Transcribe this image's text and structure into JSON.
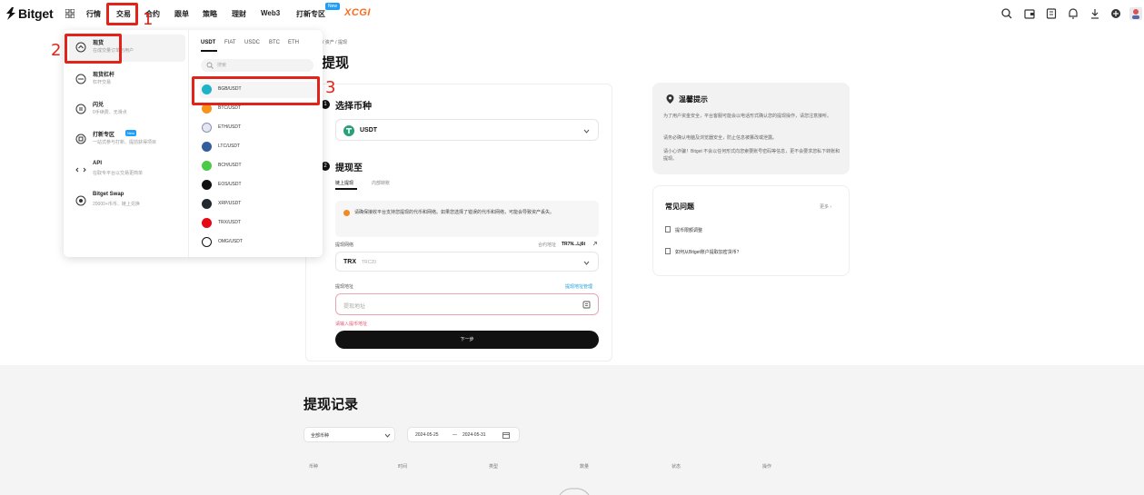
{
  "header": {
    "logo": "Bitget",
    "nav": [
      "行情",
      "交易",
      "合约",
      "跟单",
      "策略",
      "理财",
      "Web3",
      "打新专区"
    ],
    "nav_badge": "New",
    "promo": "XCGI"
  },
  "annotations": {
    "n1": "1",
    "n2": "2",
    "n3": "3"
  },
  "trade_menu": {
    "items": [
      {
        "title": "现货",
        "sub": "在成交量订单与用户"
      },
      {
        "title": "现货杠杆",
        "sub": "杠杆交易"
      },
      {
        "title": "闪兑",
        "sub": "0手续费、无滑点"
      },
      {
        "title": "打新专区",
        "sub": "一站式参与打新、提前获得项目",
        "badge": "New"
      },
      {
        "title": "API",
        "sub": "在取专平台以交易更简单"
      },
      {
        "title": "Bitget Swap",
        "sub": "20000+币币、链上兑换"
      }
    ],
    "currency_tabs": [
      "USDT",
      "FIAT",
      "USDC",
      "BTC",
      "ETH"
    ],
    "search_placeholder": "搜索",
    "pairs": [
      "BGB/USDT",
      "BTC/USDT",
      "ETH/USDT",
      "LTC/USDT",
      "BCH/USDT",
      "EOS/USDT",
      "XRP/USDT",
      "TRX/USDT",
      "OMG/USDT"
    ]
  },
  "page": {
    "breadcrumb": "/ 资产 / 提现",
    "title": "提现",
    "step1": {
      "num": "1",
      "title": "选择币种",
      "coin": "USDT"
    },
    "step2": {
      "num": "2",
      "title": "提现至",
      "tabs": [
        "链上提现",
        "内部转账"
      ],
      "notice": "请确保接收平台支持您提现的代币和网络。如果您选择了错误的代币和网络，可能会导致资产丢失。",
      "network_label": "提现网络",
      "contract_label": "合约地址",
      "contract_value": "TR7N...Lj6t",
      "network_value": "TRX",
      "network_sub": "TRC20",
      "address_label": "提现地址",
      "address_manage": "提现地址管理",
      "address_placeholder": "提现地址",
      "address_error": "请输入提币地址",
      "next_button": "下一步"
    }
  },
  "tips": {
    "title": "温馨提示",
    "p1": "为了用户资金安全，平台客服可能会以电话形式确认您的提现操作，请您注意接听。",
    "p2": "请务必确认电脑及浏览器安全，防止信息被篡改或泄露。",
    "p3": "请小心诈骗！Bitget 不会以任何形式向您索要账号密码等信息，更不会要求您私下转账和提现。"
  },
  "faq": {
    "title": "常见问题",
    "more": "更多 ›",
    "items": [
      "提币限额调整",
      "如何从Bitget账户提取加密货币？"
    ]
  },
  "history": {
    "title": "提现记录",
    "coin_filter": "全部币种",
    "date_start": "2024-05-25",
    "date_sep": "—",
    "date_end": "2024-05-31",
    "columns": [
      "币种",
      "时间",
      "类型",
      "数量",
      "状态",
      "操作"
    ]
  },
  "colors": {
    "annotation_red": "#e2231a",
    "accent_orange": "#ff6a1a",
    "badge_blue": "#1f9ef7"
  }
}
